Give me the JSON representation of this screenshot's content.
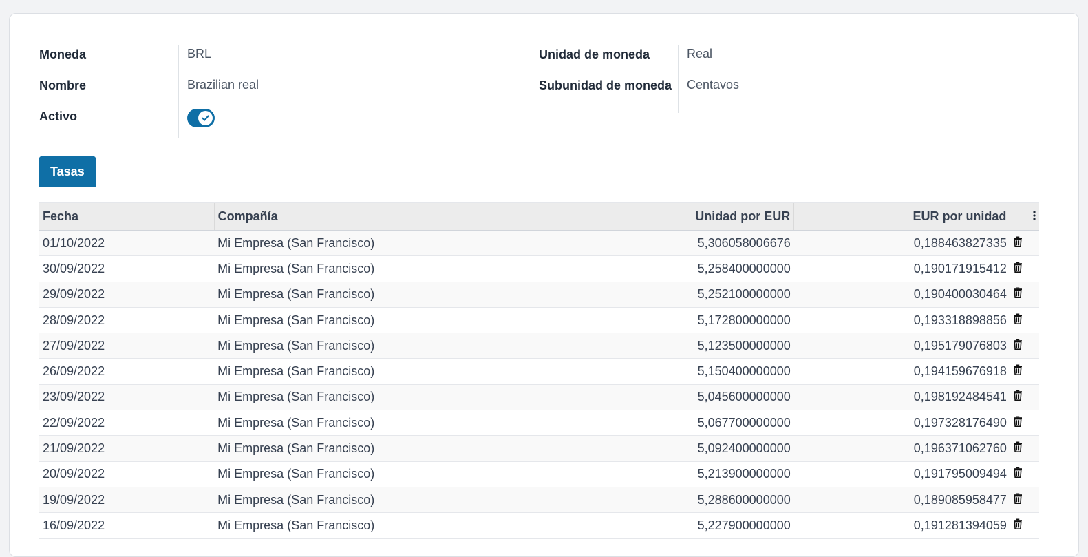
{
  "form": {
    "moneda_label": "Moneda",
    "moneda_value": "BRL",
    "nombre_label": "Nombre",
    "nombre_value": "Brazilian real",
    "activo_label": "Activo",
    "activo_value": true,
    "unidad_label": "Unidad de moneda",
    "unidad_value": "Real",
    "subunidad_label": "Subunidad de moneda",
    "subunidad_value": "Centavos"
  },
  "tabs": [
    {
      "label": "Tasas",
      "active": true
    }
  ],
  "table": {
    "headers": [
      "Fecha",
      "Compañía",
      "Unidad por EUR",
      "EUR por unidad"
    ],
    "rows": [
      {
        "date": "01/10/2022",
        "company": "Mi Empresa (San Francisco)",
        "unit_per_eur": "5,306058006676",
        "eur_per_unit": "0,188463827335"
      },
      {
        "date": "30/09/2022",
        "company": "Mi Empresa (San Francisco)",
        "unit_per_eur": "5,258400000000",
        "eur_per_unit": "0,190171915412"
      },
      {
        "date": "29/09/2022",
        "company": "Mi Empresa (San Francisco)",
        "unit_per_eur": "5,252100000000",
        "eur_per_unit": "0,190400030464"
      },
      {
        "date": "28/09/2022",
        "company": "Mi Empresa (San Francisco)",
        "unit_per_eur": "5,172800000000",
        "eur_per_unit": "0,193318898856"
      },
      {
        "date": "27/09/2022",
        "company": "Mi Empresa (San Francisco)",
        "unit_per_eur": "5,123500000000",
        "eur_per_unit": "0,195179076803"
      },
      {
        "date": "26/09/2022",
        "company": "Mi Empresa (San Francisco)",
        "unit_per_eur": "5,150400000000",
        "eur_per_unit": "0,194159676918"
      },
      {
        "date": "23/09/2022",
        "company": "Mi Empresa (San Francisco)",
        "unit_per_eur": "5,045600000000",
        "eur_per_unit": "0,198192484541"
      },
      {
        "date": "22/09/2022",
        "company": "Mi Empresa (San Francisco)",
        "unit_per_eur": "5,067700000000",
        "eur_per_unit": "0,197328176490"
      },
      {
        "date": "21/09/2022",
        "company": "Mi Empresa (San Francisco)",
        "unit_per_eur": "5,092400000000",
        "eur_per_unit": "0,196371062760"
      },
      {
        "date": "20/09/2022",
        "company": "Mi Empresa (San Francisco)",
        "unit_per_eur": "5,213900000000",
        "eur_per_unit": "0,191795009494"
      },
      {
        "date": "19/09/2022",
        "company": "Mi Empresa (San Francisco)",
        "unit_per_eur": "5,288600000000",
        "eur_per_unit": "0,189085958477"
      },
      {
        "date": "16/09/2022",
        "company": "Mi Empresa (San Francisco)",
        "unit_per_eur": "5,227900000000",
        "eur_per_unit": "0,191281394059"
      }
    ]
  },
  "colors": {
    "accent": "#0f6fa6",
    "header_bg": "#ececec"
  }
}
